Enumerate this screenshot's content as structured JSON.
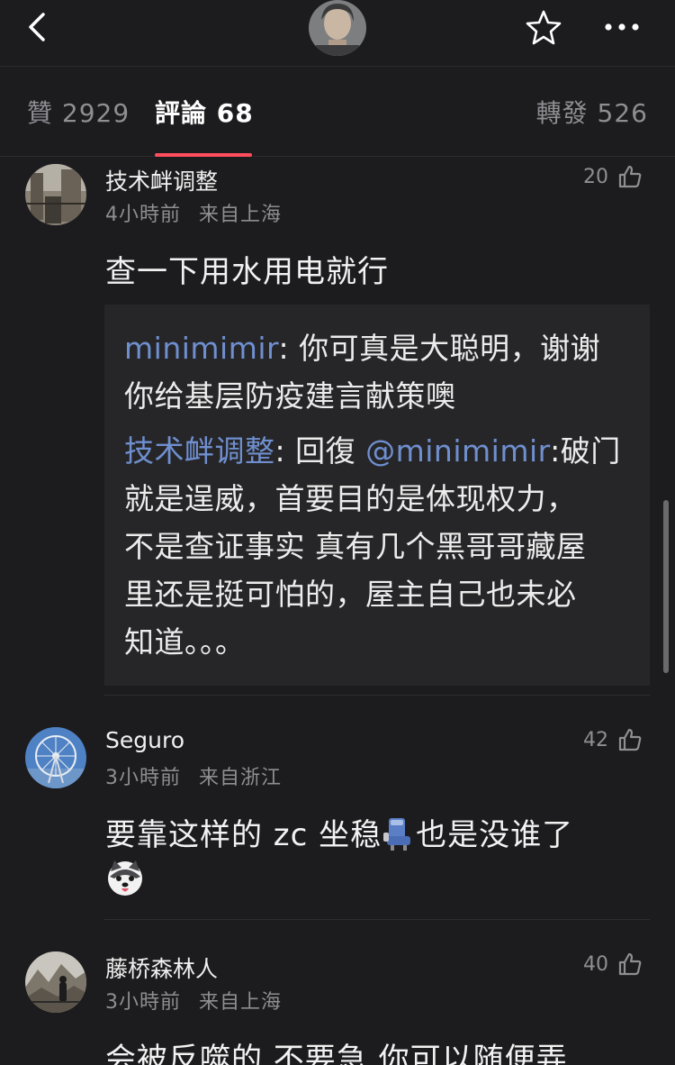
{
  "tabs": {
    "likes": "贊 2929",
    "comments": "評論 68",
    "reposts": "轉發 526"
  },
  "comments": [
    {
      "username": "技术衅调整",
      "time": "4小時前",
      "location": "来自上海",
      "likes": "20",
      "text": "查一下用水用电就行",
      "replies": [
        {
          "user": "minimimir",
          "sep": ": ",
          "text1": "你可真是大聪明，谢谢",
          "text2": "你给基层防疫建言献策噢"
        },
        {
          "user": "技术衅调整",
          "sep": ": 回復 ",
          "mention": "@minimimir",
          "colon": ":",
          "line1": "破门",
          "line2": "就是逞威，首要目的是体现权力，",
          "line3": "不是查证事实 真有几个黑哥哥藏屋",
          "line4": "里还是挺可怕的，屋主自己也未必",
          "line5": "知道。。。"
        }
      ]
    },
    {
      "username": "Seguro",
      "time": "3小時前",
      "location": "来自浙江",
      "likes": "42",
      "text_part1": "要靠这样的",
      "text_part2": " zc 坐稳",
      "text_part3": "也是没谁了",
      "emojis": [
        "seat-emoji",
        "husky-dog-emoji"
      ]
    },
    {
      "username": "藤桥森林人",
      "time": "3小時前",
      "location": "来自上海",
      "likes": "40",
      "text": "会被反噬的 不要急 你可以随便弄"
    }
  ],
  "icons": [
    "back-chevron-icon",
    "star-icon",
    "more-dots-icon",
    "thumbs-up-icon"
  ],
  "colors": {
    "background": "#1c1c1e",
    "accent_indicator": "#ff4d5e",
    "mention_blue": "#6f8fcf",
    "meta_gray": "#8e8e93"
  }
}
